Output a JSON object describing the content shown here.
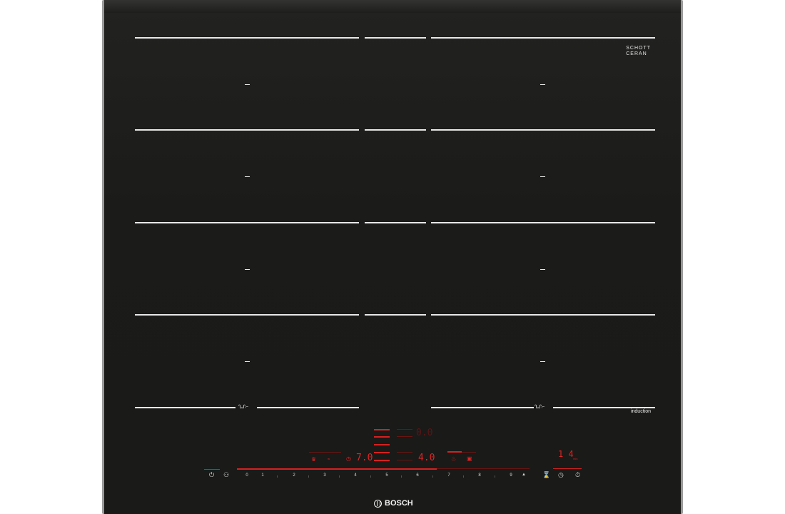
{
  "brand": {
    "name": "BOSCH",
    "glass_logo_line1": "SCHOTT",
    "glass_logo_line2": "CERAN",
    "glass_logo_sub": "",
    "model_label": "",
    "induction_label": "induction"
  },
  "controls": {
    "power_icon": "power-icon",
    "power_scale": [
      "0",
      "1",
      "2",
      "3",
      "4",
      "5",
      "6",
      "7",
      "8",
      "9"
    ],
    "zone_left_level": "7.0",
    "zone_right_level": "4.0",
    "rear_display": "0.0",
    "timer_display": "1 4",
    "icons": [
      "power-icon",
      "child-lock-icon",
      "crown-icon",
      "flex-icon",
      "timer-icon",
      "keep-warm-icon",
      "sensor-icon",
      "boost-icon",
      "hourglass-icon",
      "clock-icon",
      "stopwatch-icon"
    ]
  },
  "colors": {
    "glass": "#1a1a18",
    "frame": "#9a9a9a",
    "markings": "#e8e8e8",
    "display_red": "#e02424"
  }
}
